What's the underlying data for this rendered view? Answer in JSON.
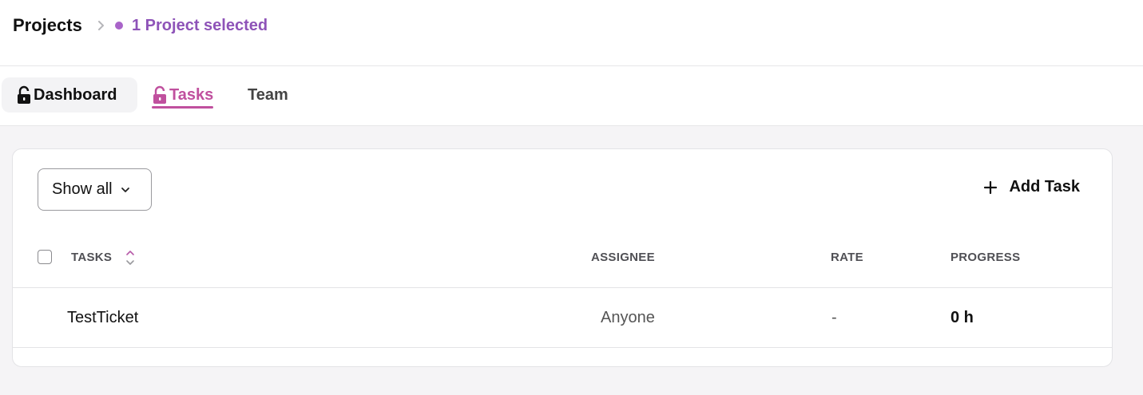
{
  "breadcrumb": {
    "title": "Projects",
    "selection": "1 Project selected"
  },
  "tabs": [
    {
      "label": "Dashboard",
      "icon": "unlock-icon",
      "active": false
    },
    {
      "label": "Tasks",
      "icon": "unlock-icon",
      "active": true
    },
    {
      "label": "Team",
      "active": false
    }
  ],
  "toolbar": {
    "filter_label": "Show all",
    "add_label": "Add Task"
  },
  "table": {
    "columns": [
      "TASKS",
      "ASSIGNEE",
      "RATE",
      "PROGRESS"
    ],
    "rows": [
      {
        "task": "TestTicket",
        "assignee": "Anyone",
        "rate": "-",
        "progress": "0 h"
      }
    ]
  },
  "colors": {
    "accent": "#c0509e",
    "selection": "#8e53b8",
    "dot": "#a964c9"
  }
}
